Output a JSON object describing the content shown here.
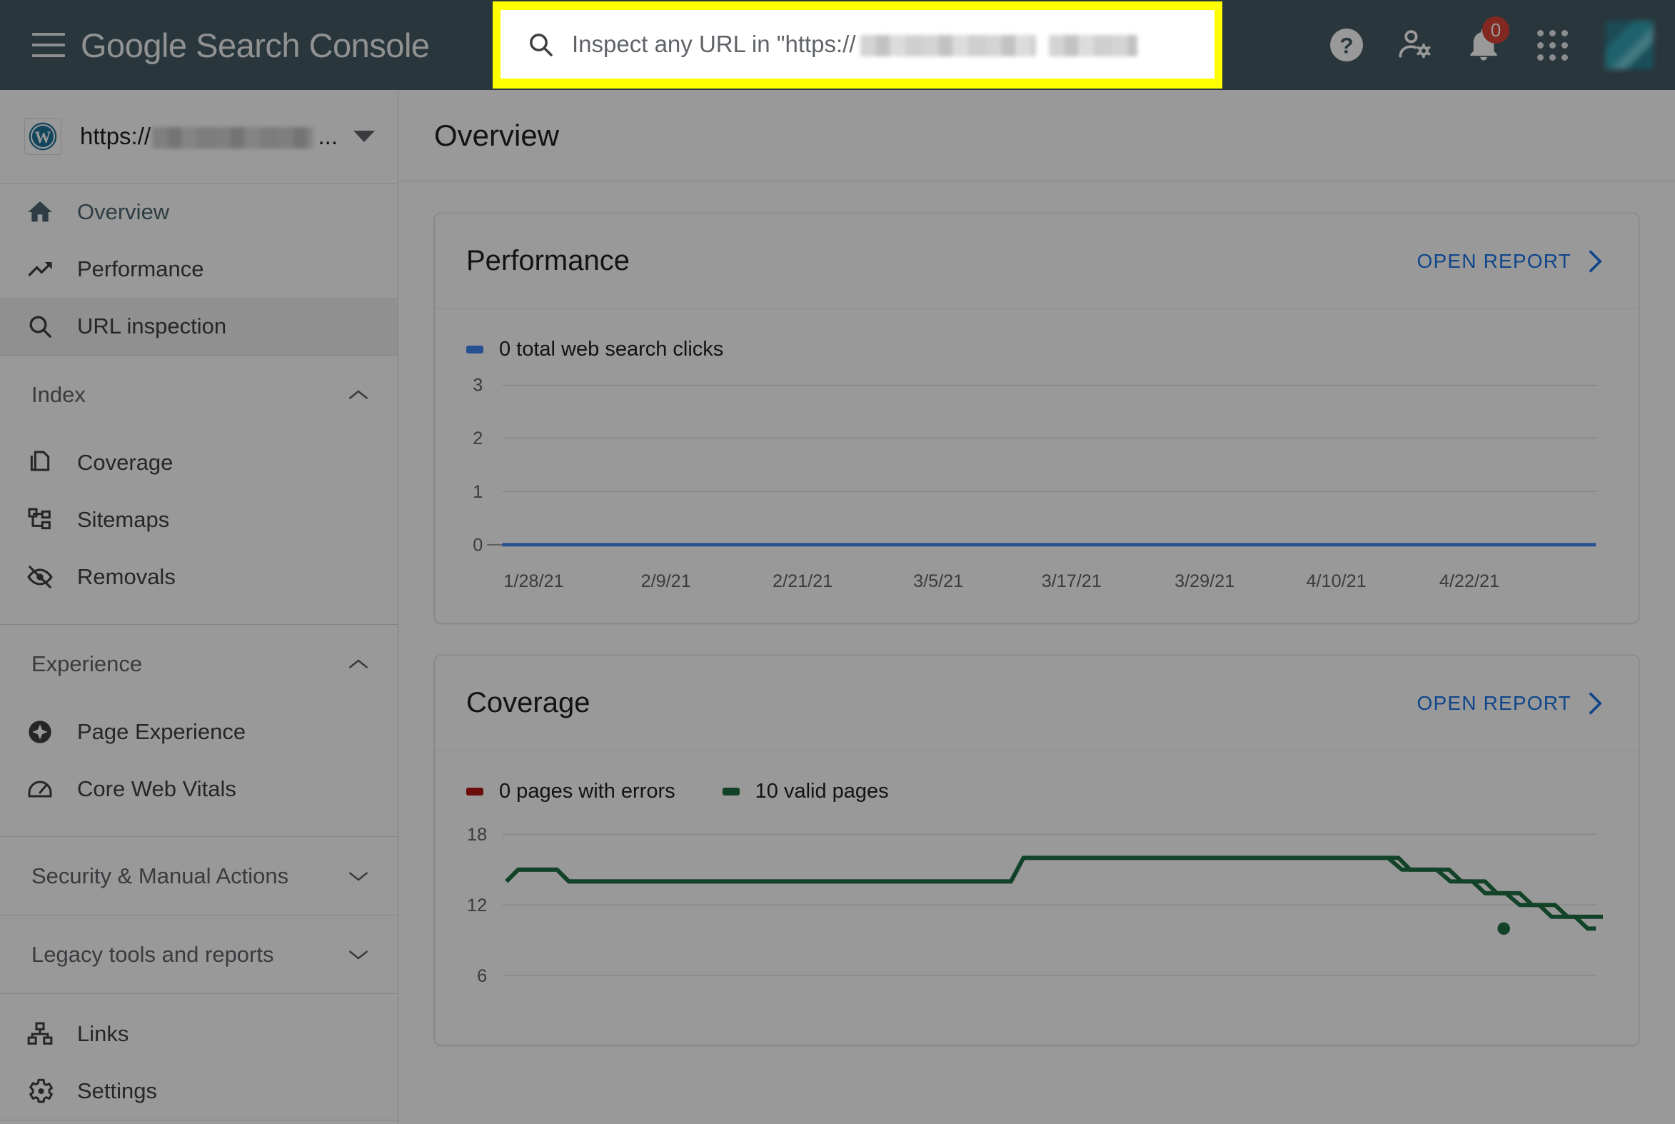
{
  "header": {
    "brand": "Google Search Console",
    "menu_icon": "hamburger-icon",
    "search": {
      "placeholder_prefix": "Inspect any URL in \"https://",
      "icon": "search-icon",
      "highlight_color": "#ffff00"
    },
    "help_label": "Help",
    "account_settings_label": "Account settings",
    "notifications_count": "0",
    "apps_label": "Google apps",
    "avatar_label": "Account"
  },
  "sidebar": {
    "property": {
      "icon": "wordpress-icon",
      "url_prefix": "https://",
      "ellipsis": "...",
      "dropdown_icon": "chevron-down-icon"
    },
    "primary_items": [
      {
        "label": "Overview",
        "icon": "home-icon",
        "state": "active"
      },
      {
        "label": "Performance",
        "icon": "trending-up-icon",
        "state": "default"
      },
      {
        "label": "URL inspection",
        "icon": "search-icon",
        "state": "hover"
      }
    ],
    "groups": [
      {
        "title": "Index",
        "expanded": true,
        "chevron": "chevron-up-icon",
        "items": [
          {
            "label": "Coverage",
            "icon": "pages-icon"
          },
          {
            "label": "Sitemaps",
            "icon": "sitemap-icon"
          },
          {
            "label": "Removals",
            "icon": "eye-off-icon"
          }
        ]
      },
      {
        "title": "Experience",
        "expanded": true,
        "chevron": "chevron-up-icon",
        "items": [
          {
            "label": "Page Experience",
            "icon": "page-experience-icon"
          },
          {
            "label": "Core Web Vitals",
            "icon": "speedometer-icon"
          }
        ]
      }
    ],
    "collapsed_sections": [
      {
        "title": "Security & Manual Actions",
        "chevron": "chevron-down-icon"
      },
      {
        "title": "Legacy tools and reports",
        "chevron": "chevron-down-icon"
      }
    ],
    "footer_items": [
      {
        "label": "Links",
        "icon": "links-icon"
      },
      {
        "label": "Settings",
        "icon": "gear-icon"
      }
    ]
  },
  "main": {
    "page_title": "Overview",
    "cards": [
      {
        "title": "Performance",
        "action_label": "OPEN REPORT",
        "action_icon": "chevron-right-icon"
      },
      {
        "title": "Coverage",
        "action_label": "OPEN REPORT",
        "action_icon": "chevron-right-icon"
      }
    ]
  },
  "colors": {
    "header_bg": "#455a64",
    "link_blue": "#1a73e8",
    "clicks_blue": "#4285f4",
    "errors_red": "#b31412",
    "valid_green": "#1e7044",
    "badge_red": "#db4437"
  },
  "chart_data": [
    {
      "type": "line",
      "title": "Performance",
      "legend": [
        {
          "label": "0 total web search clicks",
          "color": "#4285f4",
          "value": 0
        }
      ],
      "legend_position": "top-left",
      "grid": true,
      "xlabel": "",
      "ylabel": "",
      "ylim": [
        0,
        3
      ],
      "yticks": [
        "0",
        "1",
        "2",
        "3"
      ],
      "xticks": [
        "1/28/21",
        "2/9/21",
        "2/21/21",
        "3/5/21",
        "3/17/21",
        "3/29/21",
        "4/10/21",
        "4/22/21"
      ],
      "x": [
        "1/28/21",
        "2/9/21",
        "2/21/21",
        "3/5/21",
        "3/17/21",
        "3/29/21",
        "4/10/21",
        "4/22/21"
      ],
      "series": [
        {
          "name": "0 total web search clicks",
          "color": "#4285f4",
          "values": [
            0,
            0,
            0,
            0,
            0,
            0,
            0,
            0,
            0,
            0,
            0,
            0,
            0,
            0,
            0,
            0,
            0,
            0,
            0,
            0,
            0,
            0,
            0,
            0,
            0,
            0,
            0,
            0,
            0,
            0,
            0,
            0,
            0,
            0,
            0,
            0,
            0,
            0,
            0,
            0,
            0,
            0,
            0,
            0,
            0,
            0,
            0,
            0,
            0,
            0,
            0,
            0,
            0,
            0,
            0,
            0,
            0,
            0,
            0,
            0,
            0,
            0,
            0,
            0,
            0,
            0,
            0,
            0,
            0,
            0,
            0,
            0,
            0,
            0,
            0,
            0,
            0,
            0,
            0,
            0,
            0,
            0,
            0,
            0,
            0,
            0,
            0,
            0,
            0
          ]
        }
      ]
    },
    {
      "type": "line",
      "title": "Coverage",
      "legend": [
        {
          "label": "0 pages with errors",
          "color": "#b31412",
          "value": 0
        },
        {
          "label": "10 valid pages",
          "color": "#1e7044",
          "value": 10
        }
      ],
      "legend_position": "top-left",
      "grid": true,
      "xlabel": "",
      "ylabel": "",
      "ylim": [
        0,
        18
      ],
      "yticks": [
        "6",
        "12",
        "18"
      ],
      "series": [
        {
          "name": "0 pages with errors",
          "color": "#b31412",
          "values": [
            0,
            0,
            0,
            0,
            0,
            0,
            0,
            0,
            0,
            0,
            0,
            0,
            0,
            0,
            0,
            0,
            0,
            0,
            0,
            0,
            0,
            0,
            0,
            0,
            0,
            0,
            0,
            0,
            0,
            0,
            0,
            0,
            0,
            0,
            0,
            0,
            0,
            0,
            0,
            0,
            0,
            0,
            0,
            0,
            0,
            0,
            0,
            0,
            0,
            0,
            0,
            0,
            0,
            0,
            0,
            0,
            0,
            0,
            0,
            0,
            0,
            0,
            0,
            0,
            0,
            0,
            0,
            0,
            0,
            0,
            0,
            0,
            0,
            0,
            0,
            0,
            0,
            0,
            0,
            0,
            0,
            0,
            0,
            0,
            0,
            0,
            0,
            0,
            0
          ]
        },
        {
          "name": "10 valid pages",
          "color": "#1e7044",
          "values": [
            14,
            15,
            15,
            15,
            15,
            15,
            14,
            14,
            14,
            14,
            14,
            14,
            14,
            14,
            14,
            14,
            14,
            14,
            14,
            14,
            14,
            14,
            14,
            14,
            14,
            14,
            14,
            14,
            14,
            14,
            16,
            16,
            16,
            16,
            16,
            16,
            16,
            16,
            16,
            16,
            16,
            16,
            16,
            16,
            16,
            16,
            16,
            16,
            16,
            16,
            16,
            16,
            16,
            16,
            15,
            15,
            15,
            15,
            14,
            14,
            14,
            14,
            14,
            13,
            13,
            13,
            13,
            12,
            12,
            12,
            12,
            12,
            11,
            11,
            11,
            11,
            12,
            12,
            12,
            12,
            12,
            12,
            12,
            12,
            12,
            12,
            11,
            11,
            11,
            10,
            10,
            10,
            10
          ]
        }
      ]
    }
  ]
}
